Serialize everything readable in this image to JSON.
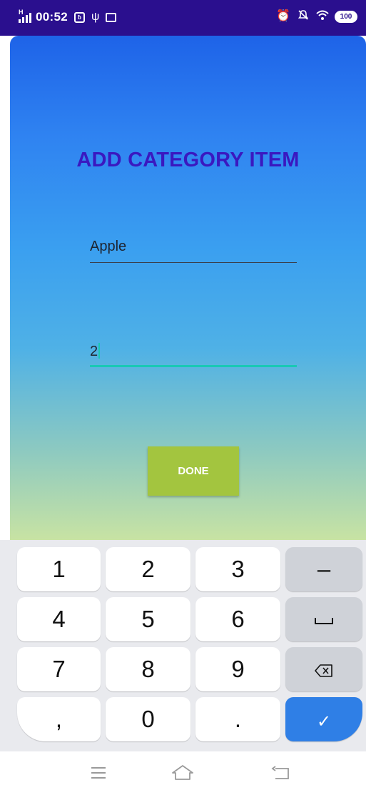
{
  "status_bar": {
    "network_label": "H",
    "time": "00:52",
    "notification_icons": [
      "bluetooth-app-icon",
      "usb-icon",
      "message-icon"
    ],
    "right_icons": [
      "alarm-icon",
      "silent-icon",
      "wifi-icon"
    ],
    "battery": "100"
  },
  "screen": {
    "title": "ADD CATEGORY ITEM",
    "item_name_value": "Apple",
    "item_quantity_value": "2",
    "done_label": "DONE"
  },
  "keyboard": {
    "rows": [
      [
        "1",
        "2",
        "3",
        "–"
      ],
      [
        "4",
        "5",
        "6",
        "space"
      ],
      [
        "7",
        "8",
        "9",
        "backspace"
      ],
      [
        ",",
        "0",
        ".",
        "enter"
      ]
    ],
    "key_labels": {
      "k1": "1",
      "k2": "2",
      "k3": "3",
      "dash": "–",
      "k4": "4",
      "k5": "5",
      "k6": "6",
      "k7": "7",
      "k8": "8",
      "k9": "9",
      "comma": ",",
      "k0": "0",
      "period": ".",
      "enter": "✓"
    }
  },
  "colors": {
    "status_bar_bg": "#2a0f8e",
    "title_color": "#3a18c0",
    "done_button_bg": "#a3c53f",
    "focused_underline": "#19c9b4",
    "enter_key_bg": "#2f7fe6"
  },
  "nav_bar": {
    "icons": [
      "menu-icon",
      "home-icon",
      "back-icon"
    ]
  }
}
